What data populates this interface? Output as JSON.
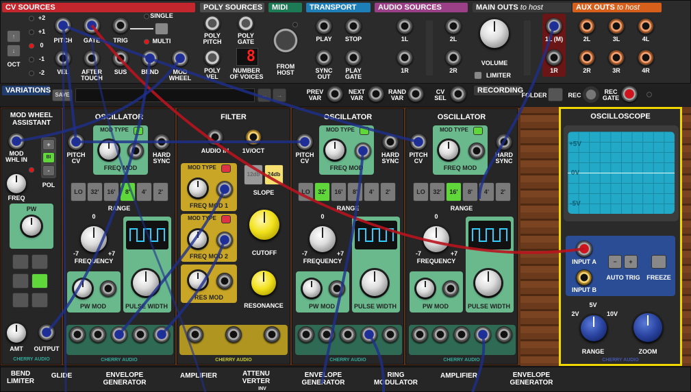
{
  "top": {
    "cv_sources": {
      "title": "CV SOURCES",
      "volt_labels": [
        "+2",
        "+1",
        "0",
        "-1",
        "-2"
      ],
      "oct": "OCT",
      "pitch": "PITCH",
      "gate": "GATE",
      "trig": "TRIG",
      "single": "SINGLE",
      "multi": "MULTI",
      "vel": "VEL",
      "aftertouch": "AFTER\nTOUCH",
      "sus": "SUS",
      "bend": "BEND",
      "mod_wheel": "MOD\nWHEEL"
    },
    "poly_sources": {
      "title": "POLY SOURCES",
      "poly_pitch": "POLY\nPITCH",
      "poly_gate": "POLY\nGATE",
      "poly_vel": "POLY\nVEL",
      "num_voices": "NUMBER\nOF VOICES",
      "voice_count": "8"
    },
    "midi": {
      "title": "MIDI",
      "from_host": "FROM\nHOST"
    },
    "transport": {
      "title": "TRANSPORT",
      "play": "PLAY",
      "stop": "STOP",
      "sync_out": "SYNC\nOUT",
      "play_gate": "PLAY\nGATE"
    },
    "audio_sources": {
      "title": "AUDIO SOURCES",
      "l1": "1L",
      "r1": "1R",
      "l2": "2L",
      "r2": "2R"
    },
    "main_outs": {
      "title": "MAIN OUTS",
      "sub": "to host",
      "volume": "VOLUME",
      "limiter": "LIMITER",
      "l1": "1L (M)",
      "r1": "1R"
    },
    "aux_outs": {
      "title": "AUX OUTS",
      "sub": "to host",
      "l2": "2L",
      "l3": "3L",
      "l4": "4L",
      "r2": "2R",
      "r3": "3R",
      "r4": "4R"
    },
    "variations": {
      "title": "VARIATIONS",
      "save": "SAVE",
      "prev": "PREV\nVAR",
      "next": "NEXT\nVAR",
      "rand": "RAND\nVAR",
      "cv_sel": "CV\nSEL"
    },
    "recording": {
      "title": "RECORDING",
      "folder": "FOLDER",
      "rec": "REC",
      "rec_gate": "REC\nGATE"
    }
  },
  "modules": {
    "mod_wheel_assistant": {
      "title": "MOD WHEEL\nASSISTANT",
      "mod_whl_in": "MOD\nWHL IN",
      "freq": "FREQ",
      "pol": "POL",
      "pol_values": [
        "+",
        "BI",
        "-"
      ],
      "pw": "PW",
      "amt": "AMT",
      "output": "OUTPUT",
      "brand": "CHERRY AUDIO"
    },
    "oscillator1": {
      "title": "OSCILLATOR",
      "mod_type": "MOD TYPE",
      "pitch_cv": "PITCH\nCV",
      "freq_mod": "FREQ MOD",
      "hard_sync": "HARD\nSYNC",
      "range_btns": [
        "LO",
        "32'",
        "16'",
        "8'",
        "4'",
        "2'"
      ],
      "range_active": 3,
      "range": "RANGE",
      "frequency": "FREQUENCY",
      "zero": "0",
      "minus7": "-7",
      "plus7": "+7",
      "pw_mod": "PW MOD",
      "pulse_width": "PULSE WIDTH",
      "brand": "CHERRY AUDIO"
    },
    "filter": {
      "title": "FILTER",
      "audio_in": "AUDIO IN",
      "one_v_oct": "1V/OCT",
      "mod_type": "MOD TYPE",
      "freq_mod1": "FREQ MOD 1",
      "freq_mod2": "FREQ MOD 2",
      "res_mod": "RES MOD",
      "slope_12": "12db",
      "slope_24": "24db",
      "slope": "SLOPE",
      "cutoff": "CUTOFF",
      "resonance": "RESONANCE",
      "brand": "CHERRY AUDIO"
    },
    "oscillator2": {
      "title": "OSCILLATOR",
      "mod_type": "MOD TYPE",
      "pitch_cv": "PITCH\nCV",
      "freq_mod": "FREQ MOD",
      "hard_sync": "HARD\nSYNC",
      "range_btns": [
        "LO",
        "32'",
        "16'",
        "8'",
        "4'",
        "2'"
      ],
      "range_active": 1,
      "range": "RANGE",
      "frequency": "FREQUENCY",
      "zero": "0",
      "minus7": "-7",
      "plus7": "+7",
      "pw_mod": "PW MOD",
      "pulse_width": "PULSE WIDTH",
      "brand": "CHERRY AUDIO"
    },
    "oscillator3": {
      "title": "OSCILLATOR",
      "mod_type": "MOD TYPE",
      "pitch_cv": "PITCH\nCV",
      "freq_mod": "FREQ MOD",
      "hard_sync": "HARD\nSYNC",
      "range_btns": [
        "LO",
        "32'",
        "16'",
        "8'",
        "4'",
        "2'"
      ],
      "range_active": 2,
      "range": "RANGE",
      "frequency": "FREQUENCY",
      "zero": "0",
      "minus7": "-7",
      "plus7": "+7",
      "pw_mod": "PW MOD",
      "pulse_width": "PULSE WIDTH",
      "brand": "CHERRY AUDIO"
    },
    "oscilloscope": {
      "title": "OSCILLOSCOPE",
      "plus5": "+5V",
      "zero": "0V",
      "minus5": "-5V",
      "input_a": "INPUT A",
      "input_b": "INPUT B",
      "minus": "−",
      "plus": "+",
      "auto_trig": "AUTO TRIG",
      "freeze": "FREEZE",
      "v2": "2V",
      "v5": "5V",
      "v10": "10V",
      "range": "RANGE",
      "zoom": "ZOOM",
      "brand": "CHERRY AUDIO"
    }
  },
  "bottom_row": [
    "BEND\nLIMITER",
    "GLIDE",
    "ENVELOPE\nGENERATOR",
    "AMPLIFIER",
    "ATTENU\nVERTER",
    "ENVELOPE\nGENERATOR",
    "RING\nMODULATOR",
    "AMPLIFIER",
    "ENVELOPE\nGENERATOR"
  ],
  "bottom_inv": "INV",
  "colors": {
    "cv": "#c3262c",
    "poly": "#4d4d4d",
    "midi": "#1c7a54",
    "transport": "#1e7fb8",
    "audio": "#9b3f86",
    "main": "#3a3a3a",
    "aux": "#d65f1c",
    "osc_green": "#69b98d",
    "filter_gold": "#c9a626",
    "scope_yellow": "#f0d700",
    "scope_screen": "#22a9c8",
    "wood": "#5c3218"
  }
}
